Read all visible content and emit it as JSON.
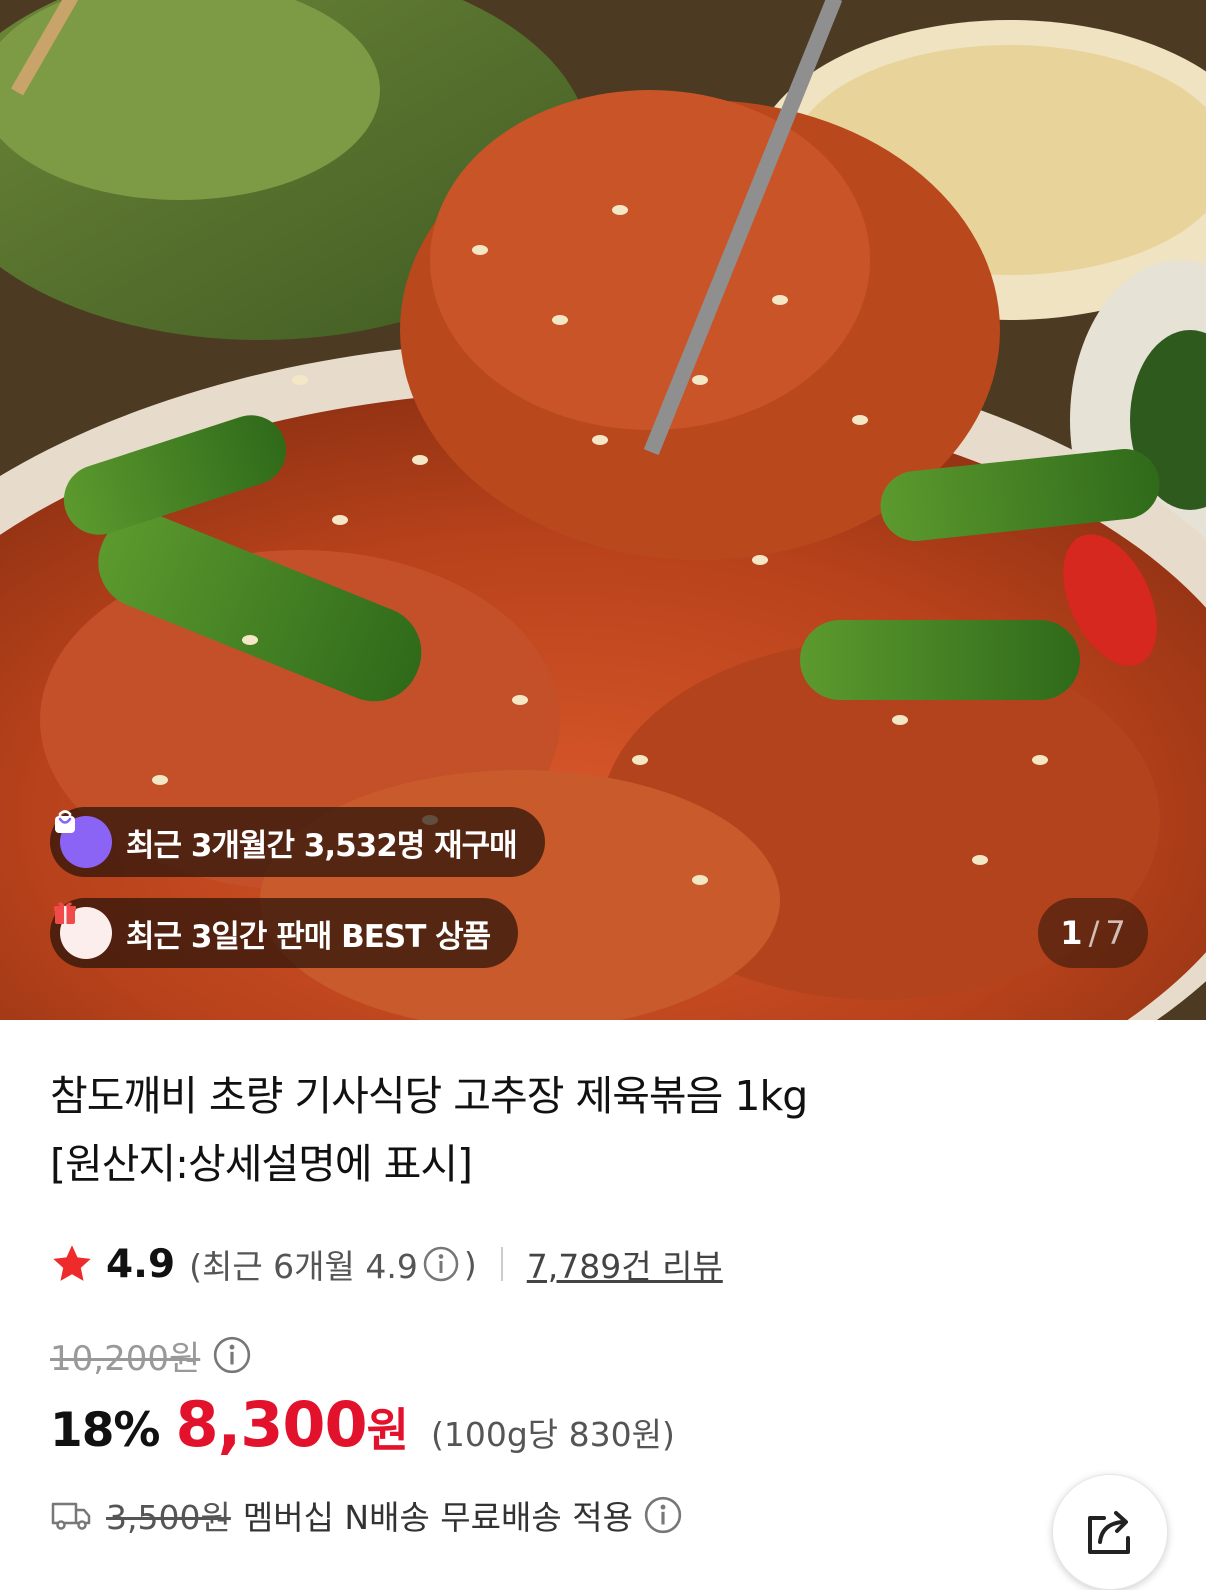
{
  "hero": {
    "badges": [
      {
        "icon": "shopping-bag-icon",
        "text": "최근 3개월간 3,532명 재구매"
      },
      {
        "icon": "gift-box-icon",
        "text": "최근 3일간 판매 BEST 상품"
      }
    ],
    "pager": {
      "current": "1",
      "separator": "/",
      "total": "7"
    }
  },
  "product": {
    "title_line1": "참도깨비 초량 기사식당 고추장 제육볶음 1kg",
    "title_line2": "[원산지:상세설명에 표시]",
    "rating": "4.9",
    "recent_rating": "(최근 6개월 4.9",
    "recent_rating_close": ")",
    "review_count": "7,789건 리뷰",
    "original_price": "10,200원",
    "discount": "18%",
    "price": "8,300",
    "price_unit": "원",
    "unit_price": "(100g당 830원)",
    "shipping_old": "3,500원",
    "shipping_text": "멤버십 N배송 무료배송 적용"
  },
  "colors": {
    "accent_red": "#e3122c",
    "star": "#ee2a2a",
    "badge_purple": "#8b63f5"
  },
  "icons": {
    "star": "star-icon",
    "info": "info-icon",
    "truck": "truck-icon",
    "share": "share-icon"
  }
}
